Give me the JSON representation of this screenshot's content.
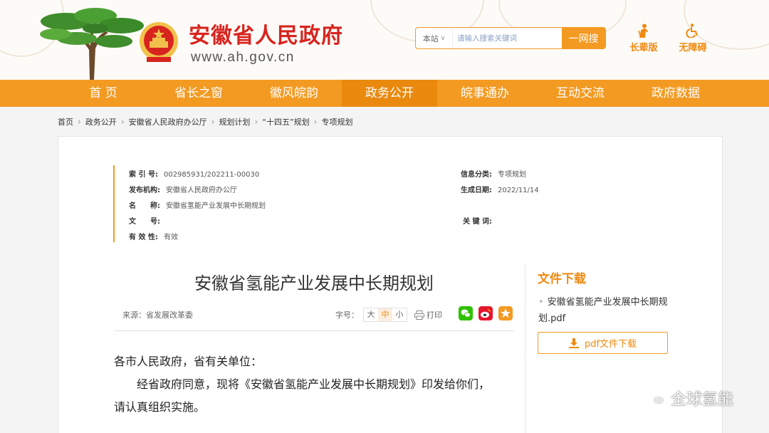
{
  "header": {
    "site_name": "安徽省人民政府",
    "site_url": "www.ah.gov.cn",
    "search": {
      "scope": "本站",
      "placeholder": "请输入搜索关键词",
      "button": "一网搜"
    },
    "tools": [
      "长辈版",
      "无障碍"
    ]
  },
  "nav": {
    "items": [
      "首 页",
      "省长之窗",
      "徽风皖韵",
      "政务公开",
      "皖事通办",
      "互动交流",
      "政府数据"
    ],
    "active_index": 3
  },
  "breadcrumb": [
    "首页",
    "政务公开",
    "安徽省人民政府办公厅",
    "规划计划",
    "“十四五”规划",
    "专项规划"
  ],
  "meta": {
    "index_label": "索 引 号:",
    "index_value": "002985931/202211-00030",
    "org_label": "发布机构:",
    "org_value": "安徽省人民政府办公厅",
    "name_label": "名　　称:",
    "name_value": "安徽省氢能产业发展中长期规划",
    "docno_label": "文　　号:",
    "docno_value": "",
    "valid_label": "有 效 性:",
    "valid_value": "有效",
    "category_label": "信息分类:",
    "category_value": "专项规划",
    "date_label": "生成日期:",
    "date_value": "2022/11/14",
    "keyword_label": "关 键 词:",
    "keyword_value": ""
  },
  "article": {
    "title": "安徽省氢能产业发展中长期规划",
    "source": "来源：省发展改革委",
    "font_label": "字号：",
    "font_sizes": [
      "大",
      "中",
      "小"
    ],
    "print": "打印",
    "paragraphs": [
      "各市人民政府，省有关单位：",
      "　　经省政府同意，现将《安徽省氢能产业发展中长期规划》印发给你们，",
      "请认真组织实施。"
    ]
  },
  "share_icons": [
    "wechat-icon",
    "weibo-icon",
    "favorite-icon"
  ],
  "download": {
    "title": "文件下载",
    "file_line1": "安徽省氢能产业发展中长期规",
    "file_line2": "划.pdf",
    "button": "pdf文件下载"
  },
  "watermark": "全球氢能",
  "colors": {
    "primary_orange": "#f39a22",
    "active_nav": "#e9890e",
    "title_red": "#d8241f"
  }
}
